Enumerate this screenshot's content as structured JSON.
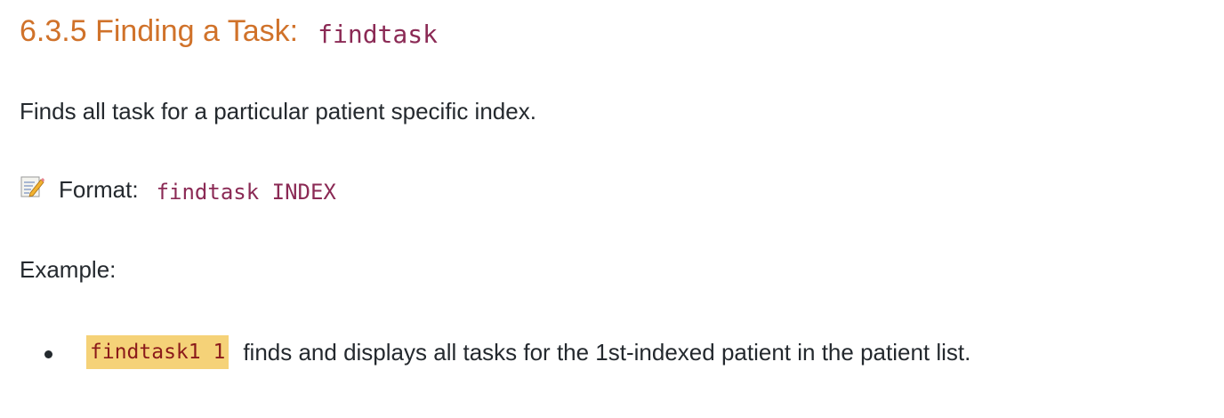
{
  "heading": {
    "title": "6.3.5 Finding a Task:",
    "code": "findtask"
  },
  "description": "Finds all task for a particular patient specific index.",
  "format": {
    "icon": "memo-icon",
    "label": "Format:",
    "code": "findtask INDEX"
  },
  "example_label": "Example:",
  "examples": [
    {
      "code": "findtask1 1",
      "text": "finds and displays all tasks for the 1st-indexed patient in the patient list."
    }
  ],
  "colors": {
    "heading": "#d0722a",
    "code": "#8b2a55",
    "highlight": "#f5d278",
    "text": "#24292e"
  }
}
